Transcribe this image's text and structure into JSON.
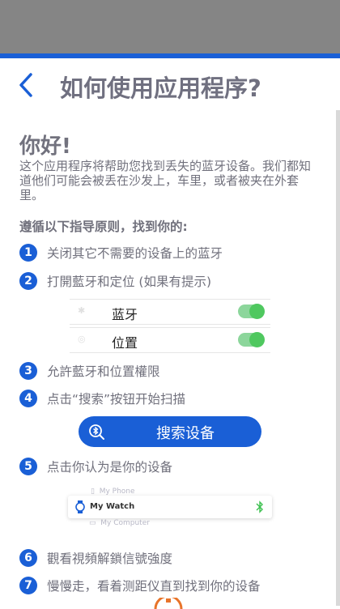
{
  "header": {
    "title": "如何使用应用程序?",
    "back_icon": "chevron-left-icon"
  },
  "intro": {
    "greeting": "你好!",
    "paragraph": "这个应用程序将帮助您找到丢失的蓝牙设备。我们都知道他们可能会被丢在沙发上，车里，或者被夹在外套里。",
    "follow_title": "遵循以下指导原则，找到你的:"
  },
  "steps": [
    {
      "num": "1",
      "text": "关闭其它不需要的设备上的蓝牙"
    },
    {
      "num": "2",
      "text": "打開藍牙和定位 (如果有提示)"
    },
    {
      "num": "3",
      "text": "允許藍牙和位置權限"
    },
    {
      "num": "4",
      "text": "点击“搜索”按钮开始扫描"
    },
    {
      "num": "5",
      "text": "点击你认为是你的设备"
    },
    {
      "num": "6",
      "text": "觀看視頻解鎖信號強度"
    },
    {
      "num": "7",
      "text": "慢慢走，看着测距仪直到找到你的设备"
    }
  ],
  "toggles": [
    {
      "label": "蓝牙",
      "on": true
    },
    {
      "label": "位置",
      "on": true
    }
  ],
  "scan_button": {
    "label": "搜索设备",
    "icon": "bluetooth-search-icon"
  },
  "devices": {
    "ghost_top": "My Phone",
    "selected": "My Watch",
    "ghost_bottom": "My Computer"
  },
  "colors": {
    "accent": "#1a5fd6",
    "toggle": "#4fc85f",
    "statusbar": "#858585"
  }
}
